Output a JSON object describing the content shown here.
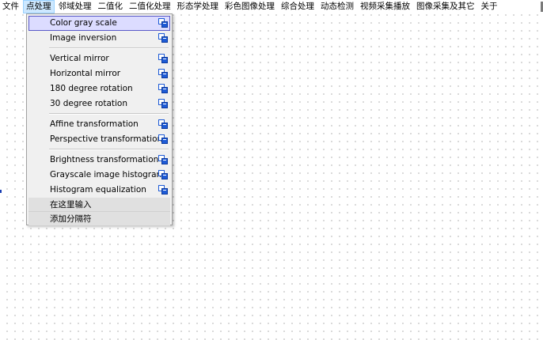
{
  "menubar": {
    "items": [
      "文件",
      "点处理",
      "邻域处理",
      "二值化",
      "二值化处理",
      "形态学处理",
      "彩色图像处理",
      "综合处理",
      "动态检测",
      "视频采集播放",
      "图像采集及其它",
      "关于"
    ],
    "active": "点处理"
  },
  "dropdown": {
    "items": [
      {
        "label": "Color gray scale",
        "icon": "submenu-edit-icon",
        "selected": true
      },
      {
        "label": "Image inversion",
        "icon": "submenu-edit-icon"
      },
      {
        "label": "Vertical mirror",
        "icon": "submenu-edit-icon"
      },
      {
        "label": "Horizontal mirror",
        "icon": "submenu-edit-icon"
      },
      {
        "label": "180 degree rotation",
        "icon": "submenu-edit-icon"
      },
      {
        "label": "30 degree rotation",
        "icon": "submenu-edit-icon"
      },
      {
        "label": "Affine transformation",
        "icon": "submenu-edit-icon"
      },
      {
        "label": "Perspective transformation",
        "icon": "submenu-edit-icon"
      },
      {
        "label": "Brightness transformation",
        "icon": "submenu-edit-icon"
      },
      {
        "label": "Grayscale image histogram",
        "icon": "submenu-edit-icon"
      },
      {
        "label": "Histogram equalization",
        "icon": "submenu-edit-icon"
      }
    ],
    "type_here": "在这里输入",
    "add_separator": "添加分隔符"
  },
  "colors": {
    "menu_active_bg": "#cde8ff",
    "menu_active_border": "#99d1ff",
    "selected_bg": "#dcdcff",
    "selected_border": "#5a5ac8",
    "icon_blue": "#1e5bd6"
  }
}
